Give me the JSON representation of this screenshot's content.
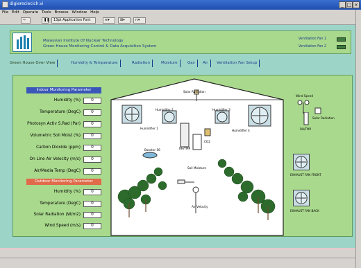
{
  "window": {
    "title": "digiereciecich.vi",
    "min": "_",
    "max": "□",
    "close": "×"
  },
  "menu": [
    "File",
    "Edit",
    "Operate",
    "Tools",
    "Browse",
    "Window",
    "Help"
  ],
  "toolbar": {
    "font": "13pt Application Font"
  },
  "header": {
    "institute": "Malaysian Institute Of Nuclear Technology",
    "system": "Green House Monitoring Control & Data Acquisition System",
    "vfan1": "Ventilation Fan 1",
    "vfan2": "Ventilation Fan 2"
  },
  "tabs": [
    "Green House Over View",
    "Humidity & Temperature",
    "Radiation",
    "Moisture",
    "Gas",
    "Air",
    "Ventilation Fan Setup"
  ],
  "indoor": {
    "title": "Indoor Monitoring Parameter",
    "rows": [
      {
        "label": "Humidity (%)",
        "value": "0"
      },
      {
        "label": "Temperature (DegC)",
        "value": "0"
      },
      {
        "label": "Photosyn Activ S.Rad (Par)",
        "value": "0"
      },
      {
        "label": "Volumetric Soil Moist (%)",
        "value": "0"
      },
      {
        "label": "Carbon Dioxide (ppm)",
        "value": "0"
      },
      {
        "label": "On Line Air Velocity (m/s)",
        "value": "0"
      },
      {
        "label": "Air/Media Temp (DegC)",
        "value": "0"
      }
    ]
  },
  "outdoor": {
    "title": "Outdoor Monitoring Parameter",
    "rows": [
      {
        "label": "Humidity (%)",
        "value": "0"
      },
      {
        "label": "Temperature (DegC)",
        "value": "0"
      },
      {
        "label": "Solar Radiation (W/m2)",
        "value": "0"
      },
      {
        "label": "Wind Speed (m/s)",
        "value": "0"
      }
    ]
  },
  "diagram": {
    "solar_radiation": "Solar Radiation",
    "humidifier1": "Humidifier 1",
    "humidifier2": "Humidifier 2",
    "humidifier3": "Humidifier 3",
    "humidifier4": "Humidifier 4",
    "rh_tmp": "RH/TMP",
    "co2": "CO2",
    "booster": "Booster 56",
    "soil_moisture": "Soil Moisture",
    "air_velocity": "Air Velocity",
    "wind_speed": "Wind Speed",
    "out_solar": "Solar Radiation",
    "out_rh": "RH/TMP",
    "exhaust_front": "EXHAUST FAN FRONT",
    "exhaust_back": "EXHAUST FAN BACK"
  },
  "colors": {
    "indoor_title_bg": "#3a56b8",
    "outdoor_title_bg": "#e06a4a",
    "panel_bg": "#a9d98d",
    "tree": "#2d6b2d"
  }
}
